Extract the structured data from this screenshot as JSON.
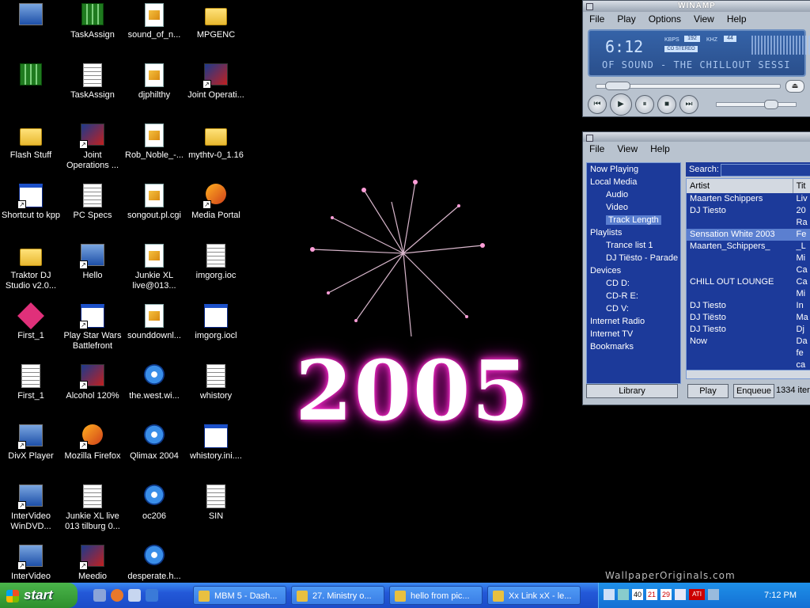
{
  "desktop": {
    "icons": [
      {
        "label": "",
        "x": 0,
        "y": 0,
        "icon": "recycle-bin-icon"
      },
      {
        "label": "TaskAssign",
        "icon": "green-app-icon"
      },
      {
        "label": "sound_of_n...",
        "icon": "script-file-icon"
      },
      {
        "label": "MPGENC",
        "icon": "folder-icon"
      },
      {
        "label": "",
        "icon": "green-doc-icon"
      },
      {
        "label": "TaskAssign",
        "icon": "config-file-icon"
      },
      {
        "label": "djphilthy",
        "icon": "script-file-icon"
      },
      {
        "label": "Joint Operati...",
        "icon": "game-shortcut-icon"
      },
      {
        "label": "Flash Stuff",
        "icon": "folder-icon"
      },
      {
        "label": "Joint Operations ...",
        "icon": "game-shortcut-icon"
      },
      {
        "label": "Rob_Noble_-...",
        "icon": "script-file-icon"
      },
      {
        "label": "mythtv-0_1.16",
        "icon": "folder-icon"
      },
      {
        "label": "Shortcut to kpp",
        "icon": "window-shortcut-icon"
      },
      {
        "label": "PC Specs",
        "icon": "text-doc-icon"
      },
      {
        "label": "songout.pl.cgi",
        "icon": "script-file-icon"
      },
      {
        "label": "Media Portal",
        "icon": "media-portal-icon"
      },
      {
        "label": "Traktor DJ Studio v2.0...",
        "icon": "folder-icon"
      },
      {
        "label": "Hello",
        "icon": "hello-shortcut-icon"
      },
      {
        "label": "Junkie XL live@013...",
        "icon": "script-file-icon"
      },
      {
        "label": "imgorg.ioc",
        "icon": "image-file-icon"
      },
      {
        "label": "First_1",
        "icon": "pink-diamond-icon"
      },
      {
        "label": "Play Star Wars Battlefront",
        "icon": "stormtrooper-icon"
      },
      {
        "label": "sounddownl...",
        "icon": "script-file-icon"
      },
      {
        "label": "imgorg.iocl",
        "icon": "app-file-icon"
      },
      {
        "label": "First_1",
        "icon": "diagram-file-icon"
      },
      {
        "label": "Alcohol 120%",
        "icon": "alcohol-shortcut-icon"
      },
      {
        "label": "the.west.wi...",
        "icon": "media-file-icon"
      },
      {
        "label": "whistory",
        "icon": "config-file-icon"
      },
      {
        "label": "DivX Player",
        "icon": "divx-shortcut-icon"
      },
      {
        "label": "Mozilla Firefox",
        "icon": "firefox-shortcut-icon"
      },
      {
        "label": "Qlimax 2004",
        "icon": "media-file-icon"
      },
      {
        "label": "whistory.ini....",
        "icon": "app-file-icon"
      },
      {
        "label": "InterVideo WinDVD...",
        "icon": "dvd-shortcut-icon"
      },
      {
        "label": "Junkie XL live 013 tilburg 0...",
        "icon": "binary-doc-icon"
      },
      {
        "label": "oc206",
        "icon": "media-file-icon"
      },
      {
        "label": "SIN",
        "icon": "text-doc-icon"
      },
      {
        "label": "InterVideo",
        "icon": "dvd-shortcut-icon"
      },
      {
        "label": "Meedio",
        "icon": "meedio-shortcut-icon"
      },
      {
        "label": "desperate.h...",
        "icon": "media-file-icon"
      }
    ],
    "wallpaper_text": "2005",
    "watermark": "WallpaperOriginals.com"
  },
  "winamp": {
    "title": "WINAMP",
    "menu": [
      "File",
      "Play",
      "Options",
      "View",
      "Help"
    ],
    "time": "6:12",
    "kbps_label": "KBPS",
    "kbps": "192",
    "khz_label": "KHZ",
    "khz": "44",
    "stereo": "CO STEREO",
    "scroll_text": "OF SOUND - THE CHILLOUT SESSI",
    "buttons": [
      "prev",
      "play",
      "pause",
      "stop",
      "next"
    ]
  },
  "library": {
    "menu": [
      "File",
      "View",
      "Help"
    ],
    "tree": [
      {
        "label": "Now Playing",
        "level": 1
      },
      {
        "label": "Local Media",
        "level": 1
      },
      {
        "label": "Audio",
        "level": 2
      },
      {
        "label": "Video",
        "level": 2
      },
      {
        "label": "Track Length",
        "level": 2,
        "selected": true
      },
      {
        "label": "Playlists",
        "level": 1
      },
      {
        "label": "Trance list 1",
        "level": 2
      },
      {
        "label": "DJ Tiësto - Parade d",
        "level": 2
      },
      {
        "label": "Devices",
        "level": 1
      },
      {
        "label": "CD D:",
        "level": 2
      },
      {
        "label": "CD-R E:",
        "level": 2
      },
      {
        "label": "CD V:",
        "level": 2
      },
      {
        "label": "Internet Radio",
        "level": 1
      },
      {
        "label": "Internet TV",
        "level": 1
      },
      {
        "label": "Bookmarks",
        "level": 1
      }
    ],
    "search_label": "Search:",
    "columns": [
      "Artist",
      "Tit"
    ],
    "rows": [
      {
        "artist": "Maarten Schippers",
        "title": "Liv"
      },
      {
        "artist": "DJ Tiesto",
        "title": "20"
      },
      {
        "artist": "",
        "title": "Ra"
      },
      {
        "artist": "Sensation White 2003",
        "title": "Fe",
        "selected": true
      },
      {
        "artist": "Maarten_Schippers_",
        "title": "_L"
      },
      {
        "artist": "",
        "title": "Mi"
      },
      {
        "artist": "",
        "title": "Ca"
      },
      {
        "artist": "CHILL OUT LOUNGE",
        "title": "Ca"
      },
      {
        "artist": "",
        "title": "Mi"
      },
      {
        "artist": "DJ Tiesto",
        "title": "In"
      },
      {
        "artist": "DJ Tiësto",
        "title": "Ma"
      },
      {
        "artist": "DJ Tiesto",
        "title": "Dj"
      },
      {
        "artist": "Now",
        "title": "Da"
      },
      {
        "artist": "",
        "title": "fe"
      },
      {
        "artist": "",
        "title": "ca"
      }
    ],
    "library_button": "Library",
    "play_button": "Play",
    "enqueue_button": "Enqueue",
    "item_count": "1334 iter"
  },
  "taskbar": {
    "start_label": "start",
    "tasks": [
      "MBM 5 - Dash...",
      "27. Ministry o...",
      "hello from pic...",
      "Xx Link xX - le..."
    ],
    "tray_temps": [
      "40",
      "21",
      "29"
    ],
    "tray_ati": "ATI",
    "clock": "7:12 PM"
  }
}
